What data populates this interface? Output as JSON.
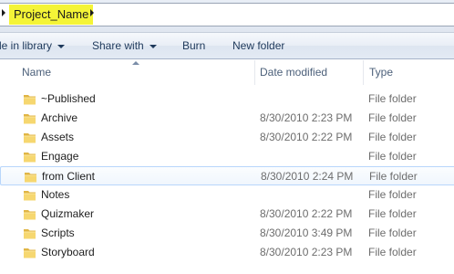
{
  "address": {
    "crumb": "Project_Name"
  },
  "toolbar": {
    "include_library": "le in library",
    "share_with": "Share with",
    "burn": "Burn",
    "new_folder": "New folder"
  },
  "columns": {
    "name": "Name",
    "date_modified": "Date modified",
    "type": "Type"
  },
  "files": [
    {
      "name": "~Published",
      "date": "",
      "type": "File folder"
    },
    {
      "name": "Archive",
      "date": "8/30/2010 2:23 PM",
      "type": "File folder"
    },
    {
      "name": "Assets",
      "date": "8/30/2010 2:22 PM",
      "type": "File folder"
    },
    {
      "name": "Engage",
      "date": "",
      "type": "File folder"
    },
    {
      "name": "from Client",
      "date": "8/30/2010 2:24 PM",
      "type": "File folder"
    },
    {
      "name": "Notes",
      "date": "",
      "type": "File folder"
    },
    {
      "name": "Quizmaker",
      "date": "8/30/2010 2:22 PM",
      "type": "File folder"
    },
    {
      "name": "Scripts",
      "date": "8/30/2010 3:49 PM",
      "type": "File folder"
    },
    {
      "name": "Storyboard",
      "date": "8/30/2010 2:23 PM",
      "type": "File folder"
    }
  ],
  "colors": {
    "crumb_highlight": "#f4f437",
    "selected_row_border": "#b8d6fb",
    "toolbar_text": "#1e395b"
  },
  "icons": {
    "folder": "folder-icon",
    "caret": "chevron-down-icon",
    "crumb_arrow": "chevron-right-icon"
  }
}
